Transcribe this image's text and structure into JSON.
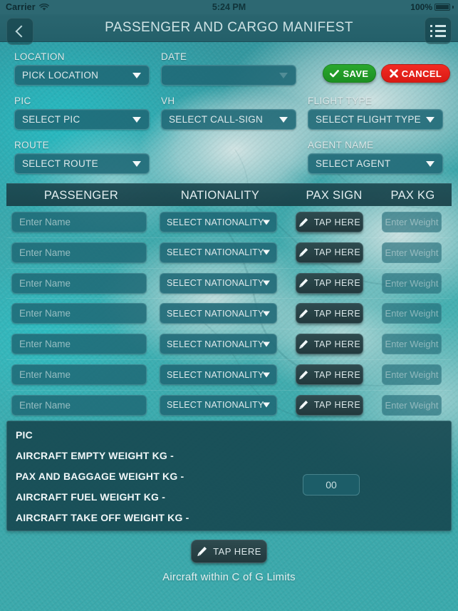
{
  "status_bar": {
    "carrier": "Carrier",
    "wifi_icon": "wifi-icon",
    "time": "5:24 PM",
    "battery_percent": "100%",
    "battery_icon": "battery-full-icon"
  },
  "nav_bar": {
    "back_icon": "chevron-left-icon",
    "title": "PASSENGER AND CARGO MANIFEST",
    "menu_icon": "list-menu-icon"
  },
  "form": {
    "location": {
      "label": "LOCATION",
      "value": "PICK LOCATION",
      "caret_icon": "chevron-down-icon"
    },
    "date": {
      "label": "DATE",
      "value": "",
      "caret_icon": "chevron-down-icon"
    },
    "pic": {
      "label": "PIC",
      "value": "SELECT PIC",
      "caret_icon": "chevron-down-icon"
    },
    "vh": {
      "label": "VH",
      "value": "SELECT CALL-SIGN",
      "caret_icon": "chevron-down-icon"
    },
    "flight_type": {
      "label": "FLIGHT TYPE",
      "value": "SELECT FLIGHT TYPE",
      "caret_icon": "chevron-down-icon"
    },
    "route": {
      "label": "ROUTE",
      "value": "SELECT ROUTE",
      "caret_icon": "chevron-down-icon"
    },
    "agent_name": {
      "label": "AGENT NAME",
      "value": "SELECT AGENT",
      "caret_icon": "chevron-down-icon"
    }
  },
  "actions": {
    "save": {
      "label": "SAVE",
      "icon": "check-icon",
      "color": "#1f9a24"
    },
    "cancel": {
      "label": "CANCEL",
      "icon": "cross-icon",
      "color": "#e21c16"
    }
  },
  "table": {
    "headers": {
      "passenger": "PASSENGER",
      "nationality": "NATIONALITY",
      "pax_sign": "PAX SIGN",
      "pax_kg": "PAX KG"
    },
    "name_placeholder": "Enter Name",
    "nationality_value": "SELECT NATIONALITY",
    "sign_label": "TAP HERE",
    "sign_icon": "pencil-icon",
    "weight_placeholder": "Enter Weight",
    "rows": [
      {
        "name": "",
        "nationality": "SELECT NATIONALITY",
        "sign": "TAP HERE",
        "weight": ""
      },
      {
        "name": "",
        "nationality": "SELECT NATIONALITY",
        "sign": "TAP HERE",
        "weight": ""
      },
      {
        "name": "",
        "nationality": "SELECT NATIONALITY",
        "sign": "TAP HERE",
        "weight": ""
      },
      {
        "name": "",
        "nationality": "SELECT NATIONALITY",
        "sign": "TAP HERE",
        "weight": ""
      },
      {
        "name": "",
        "nationality": "SELECT NATIONALITY",
        "sign": "TAP HERE",
        "weight": ""
      },
      {
        "name": "",
        "nationality": "SELECT NATIONALITY",
        "sign": "TAP HERE",
        "weight": ""
      },
      {
        "name": "",
        "nationality": "SELECT NATIONALITY",
        "sign": "TAP HERE",
        "weight": ""
      }
    ]
  },
  "summary": {
    "pic": "PIC",
    "empty_weight": "AIRCRAFT EMPTY WEIGHT KG -",
    "pax_baggage_weight": "PAX AND BAGGAGE WEIGHT KG -",
    "fuel_weight": "AIRCRAFT FUEL WEIGHT KG -",
    "takeoff_weight": "AIRCRAFT TAKE OFF WEIGHT KG -",
    "fuel_value": "00"
  },
  "footer": {
    "tap_label": "TAP HERE",
    "tap_icon": "pencil-icon",
    "cofg_status": "Aircraft within C of G Limits"
  }
}
